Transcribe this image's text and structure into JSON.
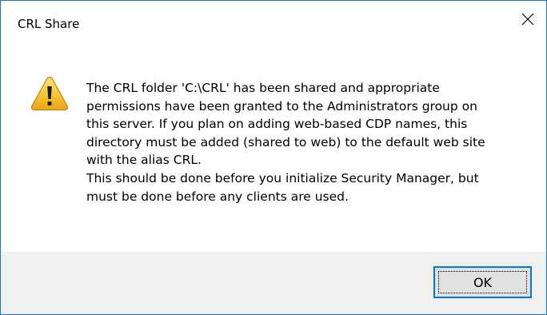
{
  "window": {
    "title": "CRL Share"
  },
  "icons": {
    "warning": "warning-icon",
    "close": "close-icon"
  },
  "message": {
    "paragraph1": "The CRL folder 'C:\\CRL' has been shared and appropriate\npermissions have been granted to the Administrators group on\nthis server. If you plan on adding web-based CDP names, this\ndirectory must be added (shared to web) to the default web site\nwith the alias CRL.",
    "paragraph2": "This should be done before you initialize Security Manager, but\nmust be done before any clients are used."
  },
  "buttons": {
    "ok_label": "OK"
  },
  "colors": {
    "accent": "#0078d7",
    "border": "#1a73c9",
    "footer_bg": "#f0f0f0",
    "warning_yellow": "#f4c430"
  }
}
